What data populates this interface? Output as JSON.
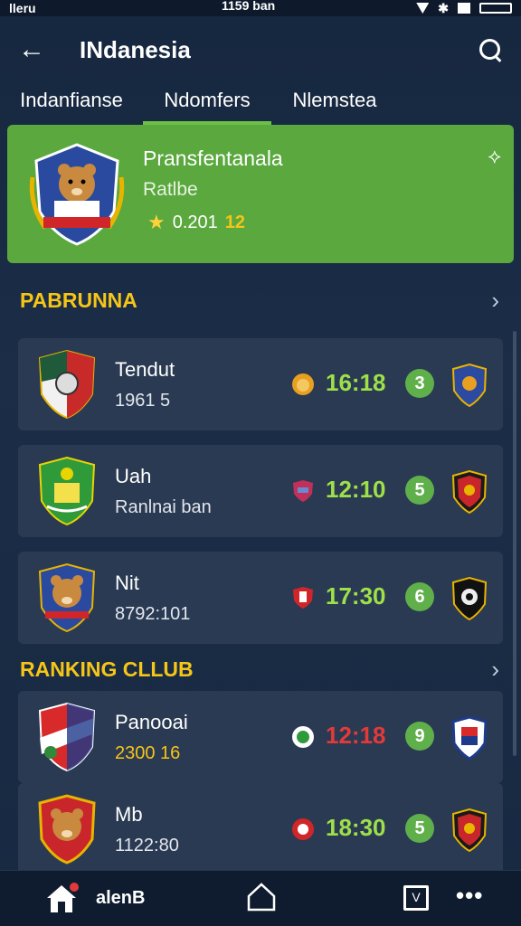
{
  "status": {
    "left": "lleru",
    "center": "1159 ban"
  },
  "app_bar": {
    "title": "INdanesia"
  },
  "tabs": [
    {
      "label": "Indanfianse"
    },
    {
      "label": "Ndomfers"
    },
    {
      "label": "Nlemstea"
    }
  ],
  "featured": {
    "name": "Pransfentanala",
    "subtitle": "Ratlbe",
    "rating_value": "0.201",
    "rating_count": "12"
  },
  "sections": [
    {
      "title": "PABRUNNA"
    },
    {
      "title": "RANKING CLLUB"
    }
  ],
  "matches": [
    {
      "name": "Tendut",
      "detail": "1961  5",
      "score": "16:18",
      "badge": "3",
      "score_color": "green"
    },
    {
      "name": "Uah",
      "detail": "Ranlnai ban",
      "score": "12:10",
      "badge": "5",
      "score_color": "green"
    },
    {
      "name": "Nit",
      "detail": "8792:101",
      "score": "17:30",
      "badge": "6",
      "score_color": "green"
    }
  ],
  "ranking": [
    {
      "name": "Panooai",
      "detail": "2300 16",
      "score": "12:18",
      "badge": "9",
      "score_color": "red"
    },
    {
      "name": "Mb",
      "detail": "1122:80",
      "score": "18:30",
      "badge": "5",
      "score_color": "green"
    }
  ],
  "bottom_nav": {
    "label": "alenB",
    "doc_glyph": "V"
  },
  "colors": {
    "accent": "#5aa83e",
    "gold": "#f5c518",
    "card": "#2a3a52"
  }
}
